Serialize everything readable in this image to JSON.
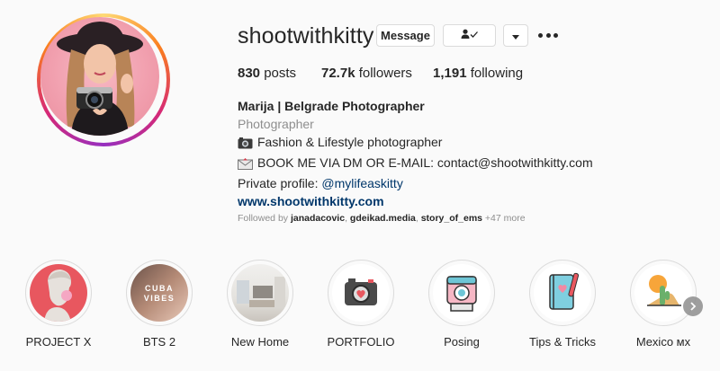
{
  "profile": {
    "username": "shootwithkitty",
    "message_button": "Message",
    "follow_icon": "following-check-icon",
    "dropdown_icon": "caret-down-icon",
    "more_icon": "more-options-icon"
  },
  "stats": {
    "posts_count": "830",
    "posts_label": " posts",
    "followers_count": "72.7k",
    "followers_label": " followers",
    "following_count": "1,191",
    "following_label": " following"
  },
  "bio": {
    "name": "Marija | Belgrade Photographer",
    "category": "Photographer",
    "line1": "Fashion & Lifestyle photographer",
    "line1_icon": "camera-emoji-icon",
    "line2": "BOOK ME VIA DM OR E-MAIL: contact@shootwithkitty.com",
    "line2_icon": "envelope-emoji-icon",
    "private_prefix": "Private profile: ",
    "private_handle": "@mylifeaskitty",
    "website": "www.shootwithkitty.com"
  },
  "followed_by": {
    "prefix": "Followed by ",
    "user1": "janadacovic",
    "sep1": ", ",
    "user2": "gdeikad.media",
    "sep2": ", ",
    "user3": "story_of_ems",
    "suffix": " +47 more"
  },
  "highlights": [
    {
      "label": "PROJECT X"
    },
    {
      "label": "BTS 2",
      "cover_text": "CUBA VIBES"
    },
    {
      "label": "New Home"
    },
    {
      "label": "PORTFOLIO"
    },
    {
      "label": "Posing"
    },
    {
      "label": "Tips & Tricks"
    },
    {
      "label": "Mexico мх"
    }
  ],
  "colors": {
    "link": "#00376b",
    "secondary_text": "#8e8e8e",
    "ring_gradient": [
      "#feda75",
      "#fa7e1e",
      "#d62976",
      "#962fbf"
    ]
  }
}
